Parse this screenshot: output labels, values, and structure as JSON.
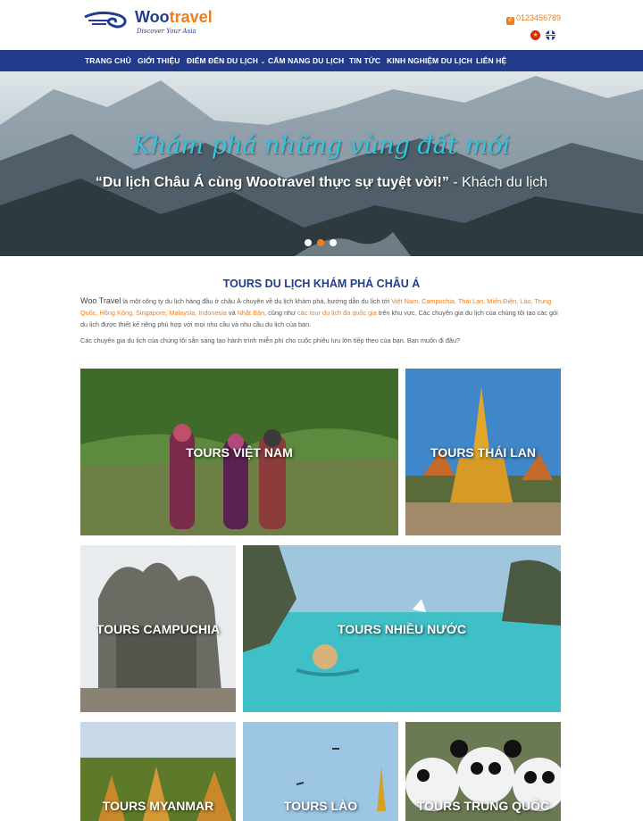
{
  "header": {
    "logo_woo": "Woo",
    "logo_travel": "travel",
    "logo_tagline": "Discover Your Asia",
    "phone": "0123456789",
    "flags": [
      "vietnam-flag-icon",
      "uk-flag-icon"
    ]
  },
  "nav": {
    "items": [
      "TRANG CHỦ",
      "GIỚI THIỆU",
      "ĐIỂM ĐẾN DU LỊCH",
      "CẨM NANG DU LỊCH",
      "TIN TỨC",
      "KINH NGHIỆM DU LỊCH",
      "LIÊN HỆ"
    ]
  },
  "hero": {
    "title": "Khám phá những vùng đất mới",
    "quote": "“Du lịch Châu Á cùng Wootravel thực sự tuyệt vời!”",
    "quote_author": " - Khách du lịch",
    "slide_count": 3,
    "active_slide": 2
  },
  "intro": {
    "title": "TOURS DU LỊCH KHÁM PHÁ CHÂU Á",
    "brand": "Woo Travel",
    "p1_a": " là một công ty du lịch hàng đầu ở châu Á chuyên về du lịch khám phá, hướng dẫn du lịch tới ",
    "countries_1": "Việt Nam, Campuchia, Thái Lan, Miến Điện, Lào, Trung Quốc, Hồng Kông, Singapore, Malaysia, Indonesia",
    "p1_and": " và ",
    "country_last": "Nhật Bản",
    "p1_b": ", cũng như ",
    "link_intl": "các tour du lịch đa quốc gia",
    "p1_c": " trên khu vực. Các chuyên gia du lịch của chúng tôi tạo các gói du lịch được thiết kế riêng phù hợp với mọi nhu cầu và nhu cầu du lịch của bạn.",
    "p2": "Các chuyên gia du lịch của chúng tôi sẵn sàng tạo hành trình miễn phí cho cuộc phiêu lưu lớn tiếp theo của bạn. Bạn muốn đi đâu?"
  },
  "tours": [
    "TOURS VIỆT NAM",
    "TOURS THÁI LAN",
    "TOURS CAMPUCHIA",
    "TOURS NHIỀU NƯỚC",
    "TOURS MYANMAR",
    "TOURS LÀO",
    "TOURS TRUNG QUỐC"
  ]
}
